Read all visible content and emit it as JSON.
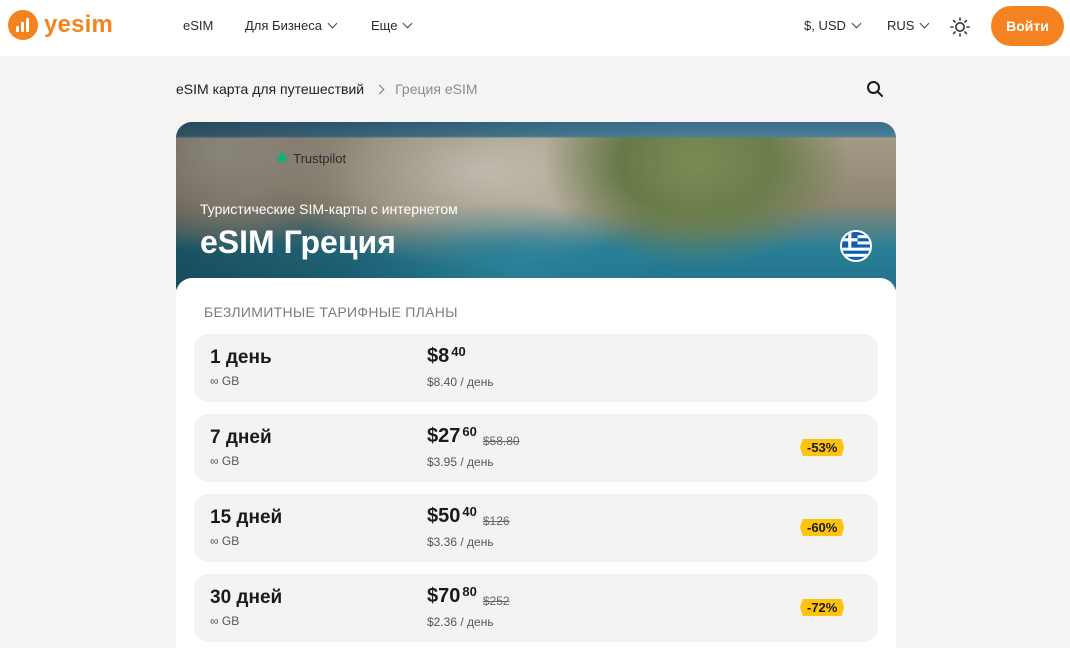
{
  "header": {
    "logo_text": "yesim",
    "nav": [
      {
        "label": "eSIM"
      },
      {
        "label": "Для Бизнеса"
      },
      {
        "label": "Еще"
      }
    ],
    "currency": "$, USD",
    "language": "RUS",
    "login_label": "Войти",
    "accent_color": "#f58220"
  },
  "breadcrumb": {
    "parent": "eSIM карта для путешествий",
    "current": "Греция eSIM"
  },
  "hero": {
    "trustpilot": "Trustpilot",
    "subtitle": "Туристические SIM-карты с интернетом",
    "title": "eSIM Греция",
    "flag": "greece-flag"
  },
  "plans_section": {
    "title": "БЕЗЛИМИТНЫЕ ТАРИФНЫЕ ПЛАНЫ",
    "plans": [
      {
        "name": "1 день",
        "data": "∞ GB",
        "price_main": "$8",
        "price_cents": "40",
        "price_old": "",
        "per_day": "$8.40 / день",
        "discount": ""
      },
      {
        "name": "7 дней",
        "data": "∞ GB",
        "price_main": "$27",
        "price_cents": "60",
        "price_old": "$58.80",
        "per_day": "$3.95 / день",
        "discount": "-53%"
      },
      {
        "name": "15 дней",
        "data": "∞ GB",
        "price_main": "$50",
        "price_cents": "40",
        "price_old": "$126",
        "per_day": "$3.36 / день",
        "discount": "-60%"
      },
      {
        "name": "30 дней",
        "data": "∞ GB",
        "price_main": "$70",
        "price_cents": "80",
        "price_old": "$252",
        "per_day": "$2.36 / день",
        "discount": "-72%"
      }
    ],
    "discount_color": "#ffc20e"
  }
}
